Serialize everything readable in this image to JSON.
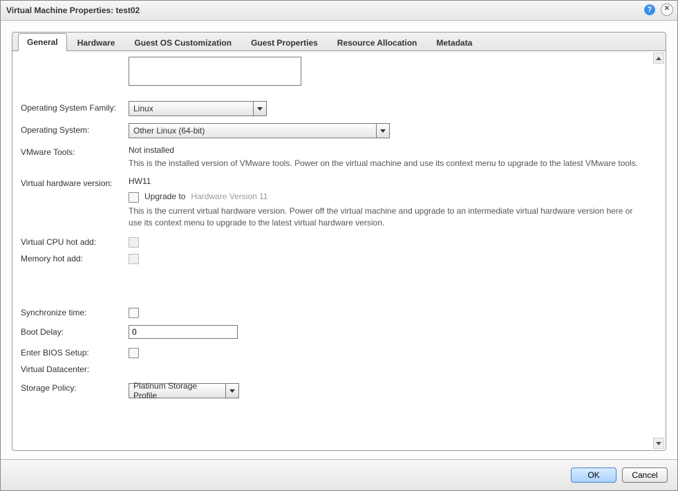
{
  "window": {
    "title": "Virtual Machine Properties: test02"
  },
  "tabs": [
    {
      "label": "General",
      "active": true
    },
    {
      "label": "Hardware"
    },
    {
      "label": "Guest OS Customization"
    },
    {
      "label": "Guest Properties"
    },
    {
      "label": "Resource Allocation"
    },
    {
      "label": "Metadata"
    }
  ],
  "general": {
    "os_family": {
      "label": "Operating System Family:",
      "value": "Linux"
    },
    "os": {
      "label": "Operating System:",
      "value": "Other Linux (64-bit)"
    },
    "vmware_tools": {
      "label": "VMware Tools:",
      "value": "Not installed",
      "info": "This is the installed version of VMware tools. Power on the virtual machine and use its context menu to upgrade to the latest VMware tools."
    },
    "hw_version": {
      "label": "Virtual hardware version:",
      "value": "HW11",
      "upgrade_label": "Upgrade to",
      "upgrade_target": "Hardware Version 11",
      "info": "This is the current virtual hardware version. Power off the virtual machine and upgrade to an intermediate virtual hardware version here or use its context menu to upgrade to the latest virtual hardware version."
    },
    "cpu_hot_add": {
      "label": "Virtual CPU hot add:"
    },
    "mem_hot_add": {
      "label": "Memory hot add:"
    },
    "sync_time": {
      "label": "Synchronize time:"
    },
    "boot_delay": {
      "label": "Boot Delay:",
      "value": "0"
    },
    "bios_setup": {
      "label": "Enter BIOS Setup:"
    },
    "vdc": {
      "label": "Virtual Datacenter:"
    },
    "storage_policy": {
      "label": "Storage Policy:",
      "value": "Platinum Storage Profile"
    }
  },
  "buttons": {
    "ok": "OK",
    "cancel": "Cancel"
  }
}
